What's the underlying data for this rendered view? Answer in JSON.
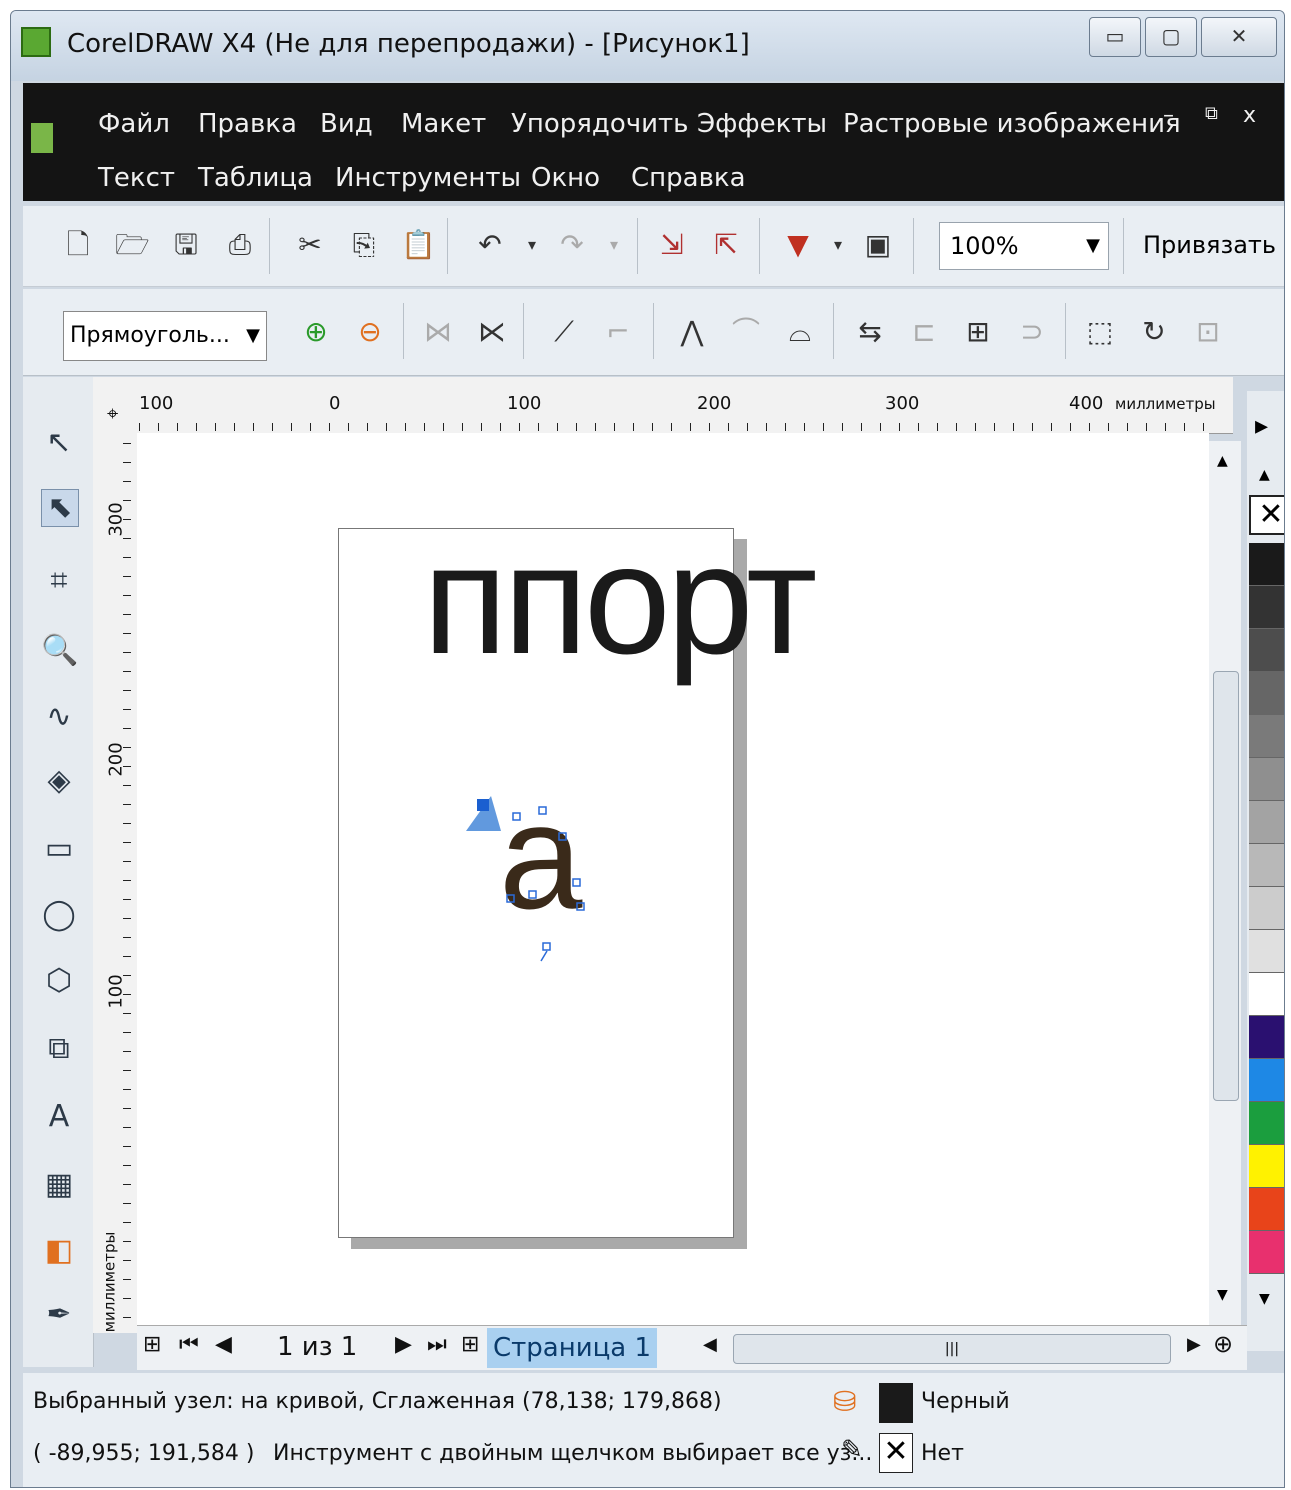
{
  "window": {
    "title": "CorelDRAW X4 (Не для перепродажи) - [Рисунок1]"
  },
  "menubar": {
    "row1": [
      "Файл",
      "Правка",
      "Вид",
      "Макет",
      "Упорядочить",
      "Эффекты",
      "Растровые изображения"
    ],
    "row2": [
      "Текст",
      "Таблица",
      "Инструменты",
      "Окно",
      "Справка"
    ]
  },
  "toolbar": {
    "zoom": "100%",
    "snap_label": "Привязать к"
  },
  "propertybar": {
    "shape_select": "Прямоуголь..."
  },
  "rulers": {
    "horizontal": [
      "100",
      "0",
      "100",
      "200",
      "300",
      "400"
    ],
    "unit": "миллиметры",
    "vertical": [
      "300",
      "200",
      "100"
    ]
  },
  "canvas": {
    "text": "ппорт",
    "selected_glyph": "а"
  },
  "pagenav": {
    "page_count": "1 из 1",
    "page_tab": "Страница 1"
  },
  "status": {
    "line1": "Выбранный узел: на кривой, Сглаженная (78,138; 179,868)",
    "line2_coords": "( -89,955; 191,584 )",
    "line2_hint": "Инструмент с двойным щелчком выбирает все уз...",
    "fill_label": "Черный",
    "outline_label": "Нет"
  },
  "palette": [
    "#1a1a1a",
    "#333333",
    "#4d4d4d",
    "#666666",
    "#7a7a7a",
    "#8f8f8f",
    "#a3a3a3",
    "#b8b8b8",
    "#cccccc",
    "#e0e0e0",
    "#ffffff",
    "#2a1070",
    "#1e88e5",
    "#1b9e3e",
    "#fff200",
    "#e8441a",
    "#e8306e"
  ],
  "icons": {
    "new": "new-document-icon",
    "open": "open-folder-icon",
    "save": "save-icon",
    "print": "print-icon",
    "cut": "scissors-icon",
    "copy": "copy-icon",
    "paste": "paste-icon",
    "undo": "undo-icon",
    "redo": "redo-icon"
  }
}
